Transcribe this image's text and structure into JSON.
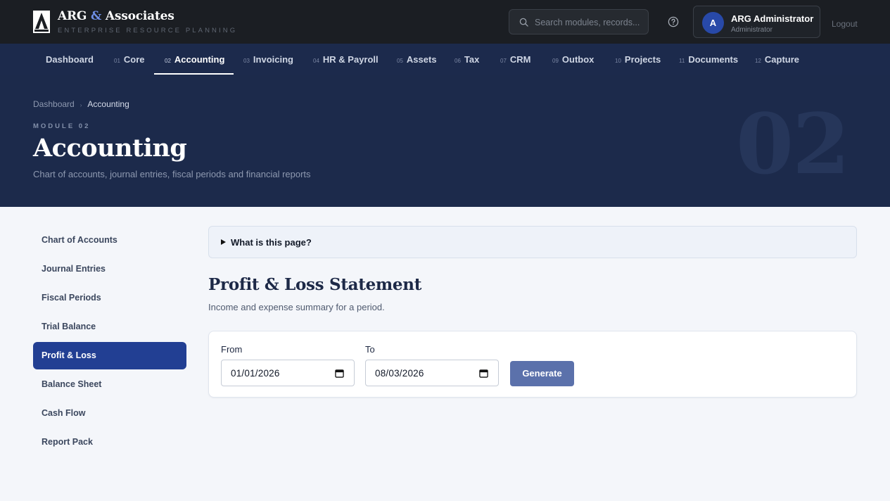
{
  "brand": {
    "name_part1": "ARG",
    "name_amp": "&",
    "name_part2": "Associates",
    "subtitle": "ENTERPRISE RESOURCE PLANNING",
    "logo_icon": "arg-logo-icon"
  },
  "header": {
    "search_placeholder": "Search modules, records...",
    "user_initial": "A",
    "user_name": "ARG Administrator",
    "user_role": "Administrator",
    "logout_label": "Logout"
  },
  "nav": {
    "items": [
      {
        "num": "",
        "label": "Dashboard"
      },
      {
        "num": "01",
        "label": "Core"
      },
      {
        "num": "02",
        "label": "Accounting"
      },
      {
        "num": "03",
        "label": "Invoicing"
      },
      {
        "num": "04",
        "label": "HR & Payroll"
      },
      {
        "num": "05",
        "label": "Assets"
      },
      {
        "num": "06",
        "label": "Tax"
      },
      {
        "num": "07",
        "label": "CRM"
      },
      {
        "num": "09",
        "label": "Outbox"
      },
      {
        "num": "10",
        "label": "Projects"
      },
      {
        "num": "11",
        "label": "Documents"
      },
      {
        "num": "12",
        "label": "Capture"
      }
    ],
    "active": "Accounting"
  },
  "hero": {
    "breadcrumb": [
      "Dashboard",
      "Accounting"
    ],
    "eyebrow": "MODULE 02",
    "title": "Accounting",
    "description": "Chart of accounts, journal entries, fiscal periods and financial reports",
    "module_number": "02"
  },
  "sidebar": {
    "items": [
      {
        "label": "Chart of Accounts"
      },
      {
        "label": "Journal Entries"
      },
      {
        "label": "Fiscal Periods"
      },
      {
        "label": "Trial Balance"
      },
      {
        "label": "Profit & Loss"
      },
      {
        "label": "Balance Sheet"
      },
      {
        "label": "Cash Flow"
      },
      {
        "label": "Report Pack"
      }
    ],
    "active": "Profit & Loss"
  },
  "main": {
    "info_toggle": "What is this page?",
    "title": "Profit & Loss Statement",
    "description": "Income and expense summary for a period.",
    "form": {
      "from_label": "From",
      "from_value": "01/01/2026",
      "to_label": "To",
      "to_value": "08/03/2026",
      "generate_label": "Generate"
    }
  },
  "colors": {
    "topbar_bg": "#1b1e23",
    "nav_bg": "#1c2a4c",
    "hero_bg": "#1c2a4b",
    "accent": "#223f93",
    "button": "#5b71ab",
    "page_bg": "#f4f6fa"
  }
}
